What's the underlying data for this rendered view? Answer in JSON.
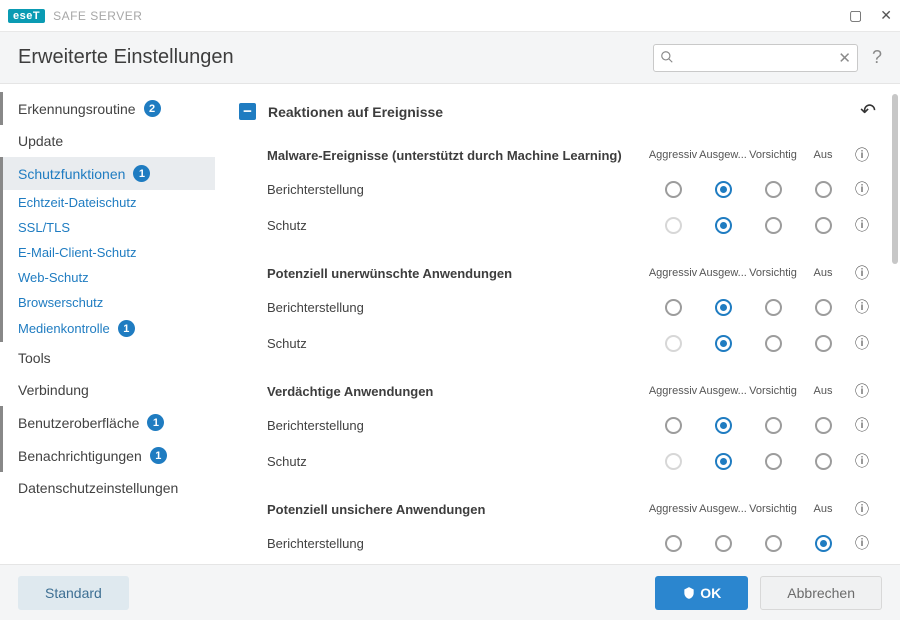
{
  "brand": {
    "logo_text": "eseT",
    "product": "SAFE SERVER"
  },
  "header": {
    "title": "Erweiterte Einstellungen"
  },
  "search": {
    "value": "",
    "placeholder": ""
  },
  "sidebar": {
    "items": [
      {
        "label": "Erkennungsroutine",
        "badge": "2"
      },
      {
        "label": "Update"
      },
      {
        "label": "Schutzfunktionen",
        "badge": "1"
      },
      {
        "label": "Echtzeit-Dateischutz"
      },
      {
        "label": "SSL/TLS"
      },
      {
        "label": "E-Mail-Client-Schutz"
      },
      {
        "label": "Web-Schutz"
      },
      {
        "label": "Browserschutz"
      },
      {
        "label": "Medienkontrolle",
        "badge": "1"
      },
      {
        "label": "Tools"
      },
      {
        "label": "Verbindung"
      },
      {
        "label": "Benutzeroberfläche",
        "badge": "1"
      },
      {
        "label": "Benachrichtigungen",
        "badge": "1"
      },
      {
        "label": "Datenschutzeinstellungen"
      }
    ]
  },
  "columns": {
    "c0": "Aggressiv",
    "c1": "Ausgew...",
    "c2": "Vorsichtig",
    "c3": "Aus"
  },
  "section": {
    "title": "Reaktionen auf Ereignisse",
    "groups": [
      {
        "title": "Malware-Ereignisse (unterstützt durch Machine Learning)",
        "rows": [
          {
            "label": "Berichterstellung",
            "selected": 1,
            "disabled": []
          },
          {
            "label": "Schutz",
            "selected": 1,
            "disabled": [
              0
            ]
          }
        ]
      },
      {
        "title": "Potenziell unerwünschte Anwendungen",
        "rows": [
          {
            "label": "Berichterstellung",
            "selected": 1,
            "disabled": []
          },
          {
            "label": "Schutz",
            "selected": 1,
            "disabled": [
              0
            ]
          }
        ]
      },
      {
        "title": "Verdächtige Anwendungen",
        "rows": [
          {
            "label": "Berichterstellung",
            "selected": 1,
            "disabled": []
          },
          {
            "label": "Schutz",
            "selected": 1,
            "disabled": [
              0
            ]
          }
        ]
      },
      {
        "title": "Potenziell unsichere Anwendungen",
        "rows": [
          {
            "label": "Berichterstellung",
            "selected": 3,
            "disabled": []
          }
        ]
      }
    ]
  },
  "footer": {
    "standard": "Standard",
    "ok": "OK",
    "cancel": "Abbrechen"
  }
}
